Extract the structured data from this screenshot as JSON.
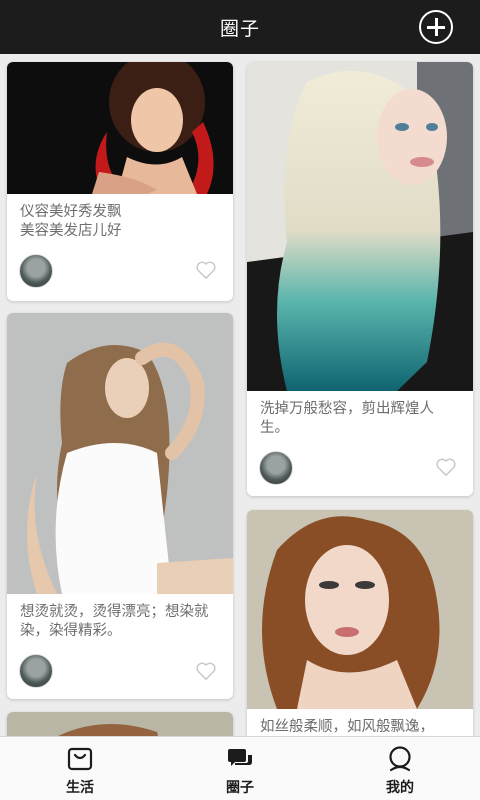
{
  "header": {
    "title": "圈子"
  },
  "feed": {
    "posts": [
      {
        "caption": "仪容美好秀发飘\n美容美发店儿好"
      },
      {
        "caption": "洗掉万般愁容，剪出辉煌人生。"
      },
      {
        "caption": "想烫就烫，烫得漂亮；想染就染，染得精彩。"
      },
      {
        "caption": "如丝般柔顺，如风般飘逸，"
      },
      {
        "caption": ""
      }
    ]
  },
  "tabbar": {
    "tabs": [
      {
        "label": "生活",
        "icon": "shopping-bag-icon"
      },
      {
        "label": "圈子",
        "icon": "chat-bubbles-icon",
        "active": true
      },
      {
        "label": "我的",
        "icon": "user-icon"
      }
    ]
  }
}
